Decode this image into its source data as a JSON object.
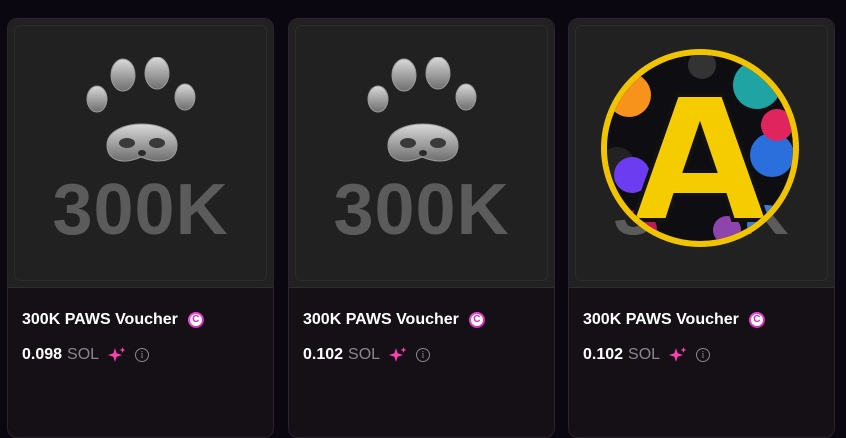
{
  "cards": [
    {
      "title": "300K PAWS Voucher",
      "badge": "C",
      "price": "0.098",
      "unit": "SOL",
      "image_text": "300K",
      "info": "i"
    },
    {
      "title": "300K PAWS Voucher",
      "badge": "C",
      "price": "0.102",
      "unit": "SOL",
      "image_text": "300K",
      "info": "i"
    },
    {
      "title": "300K PAWS Voucher",
      "badge": "C",
      "price": "0.102",
      "unit": "SOL",
      "image_text": "300K",
      "overlay_letter": "A",
      "info": "i"
    }
  ],
  "colors": {
    "background": "#0b0710",
    "card": "#141016",
    "badge": "#d12ab8",
    "sparkle": "#ff3fb4",
    "avatar_ring": "#f0c400"
  },
  "icons": {
    "badge": "c-badge-icon",
    "sparkle": "sparkle-icon",
    "info": "info-icon",
    "paw": "paw-icon"
  }
}
